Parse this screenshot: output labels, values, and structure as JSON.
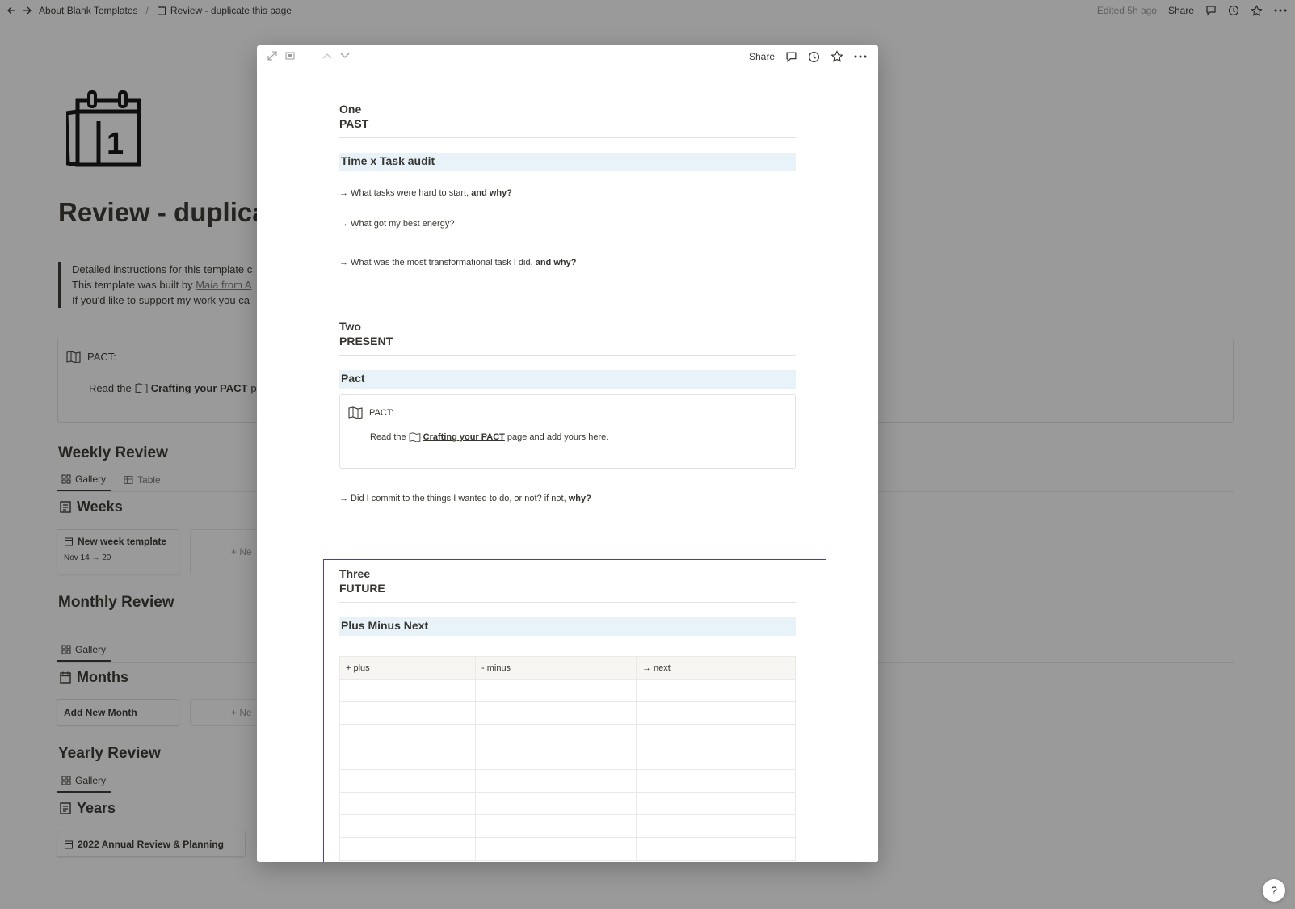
{
  "topbar": {
    "breadcrumbs": [
      "About Blank Templates",
      "Review - duplicate this page"
    ],
    "separator": "/",
    "edited": "Edited 5h ago",
    "share_label": "Share"
  },
  "background_page": {
    "title": "Review - duplica",
    "quote_lines": [
      "Detailed instructions for this template c",
      "This template was built by ",
      "If you'd like to support my work you ca"
    ],
    "quote_link": "Maia from A",
    "callout": {
      "title": "PACT:",
      "body_prefix": "Read the",
      "link": "Crafting your PACT",
      "body_suffix": "pa"
    },
    "weekly": {
      "heading": "Weekly Review",
      "tabs": [
        "Gallery",
        "Table"
      ],
      "db_title": "Weeks",
      "card_title": "New week template",
      "card_date": "Nov 14 → 20",
      "new_label": "Ne"
    },
    "monthly": {
      "heading": "Monthly Review",
      "tabs": [
        "Gallery"
      ],
      "db_title": "Months",
      "card_title": "Add New Month",
      "new_label": "Ne"
    },
    "yearly": {
      "heading": "Yearly Review",
      "tabs": [
        "Gallery"
      ],
      "db_title": "Years",
      "card_title": "2022 Annual Review & Planning"
    },
    "help_label": "?"
  },
  "modal": {
    "share_label": "Share",
    "sections": {
      "one": {
        "num": "One",
        "label": "PAST",
        "band": "Time x Task audit"
      },
      "two": {
        "num": "Two",
        "label": "PRESENT",
        "band": "Pact"
      },
      "three": {
        "num": "Three",
        "label": "FUTURE",
        "band": "Plus Minus Next"
      }
    },
    "questions": {
      "q1": "→ What tasks were hard to start, ",
      "q1b": "and why?",
      "q2": "→ What got my best energy?",
      "q3": "→ What was the most transformational task I did, ",
      "q3b": "and why?",
      "q4": "→ Did I commit to the things I wanted to do, or not? if not, ",
      "q4b": "why?"
    },
    "callout": {
      "title": "PACT:",
      "body_prefix": "Read the",
      "link": "Crafting your PACT",
      "body_suffix": "page and add yours here."
    },
    "table": {
      "headers": [
        "+ plus",
        "- minus",
        "→ next"
      ],
      "empty_rows": 8
    }
  },
  "colors": {
    "selection": "#3b3bd6",
    "band": "#e7f3f8"
  }
}
